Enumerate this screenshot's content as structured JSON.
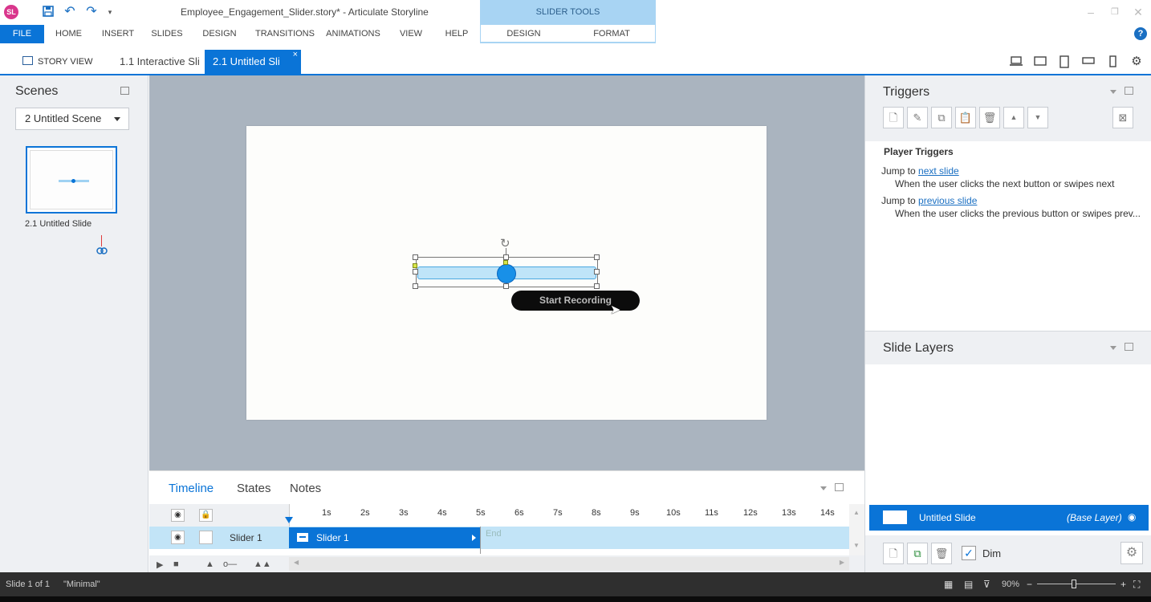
{
  "title_bar": {
    "app_logo": "SL",
    "document_title": "Employee_Engagement_Slider.story* - Articulate Storyline",
    "contextual_group": "SLIDER TOOLS"
  },
  "ribbon": {
    "file": "FILE",
    "tabs": [
      "HOME",
      "INSERT",
      "SLIDES",
      "DESIGN",
      "TRANSITIONS",
      "ANIMATIONS",
      "VIEW",
      "HELP"
    ],
    "tool_tabs": [
      "DESIGN",
      "FORMAT"
    ],
    "help": "?"
  },
  "doc_tabs": {
    "story_view": "STORY VIEW",
    "tab1": "1.1 Interactive Sli",
    "tab2": "2.1 Untitled Sli",
    "close": "×"
  },
  "scenes": {
    "title": "Scenes",
    "selected_scene": "2 Untitled Scene",
    "slide_label": "2.1 Untitled Slide"
  },
  "canvas": {
    "recording_pill": "Start Recording"
  },
  "timeline": {
    "tabs": [
      "Timeline",
      "States",
      "Notes"
    ],
    "ticks": [
      "1s",
      "2s",
      "3s",
      "4s",
      "5s",
      "6s",
      "7s",
      "8s",
      "9s",
      "10s",
      "11s",
      "12s",
      "13s",
      "14s"
    ],
    "row_name": "Slider 1",
    "bar_label": "Slider 1",
    "end_label": "End"
  },
  "triggers": {
    "title": "Triggers",
    "section": "Player Triggers",
    "items": [
      {
        "action": "Jump to",
        "target": "next slide",
        "condition": "When the user clicks the next button or swipes next"
      },
      {
        "action": "Jump to",
        "target": "previous slide",
        "condition": "When the user clicks the previous button or swipes prev..."
      }
    ]
  },
  "layers": {
    "title": "Slide Layers",
    "layer_name": "Untitled Slide",
    "layer_type": "(Base Layer)",
    "dim_label": "Dim"
  },
  "status_bar": {
    "slide": "Slide 1 of 1",
    "theme": "\"Minimal\"",
    "zoom": "90%"
  },
  "colors": {
    "accent": "#0a74d7",
    "slider_tools": "#a8d4f3",
    "canvas_bg": "#aab4bf"
  }
}
